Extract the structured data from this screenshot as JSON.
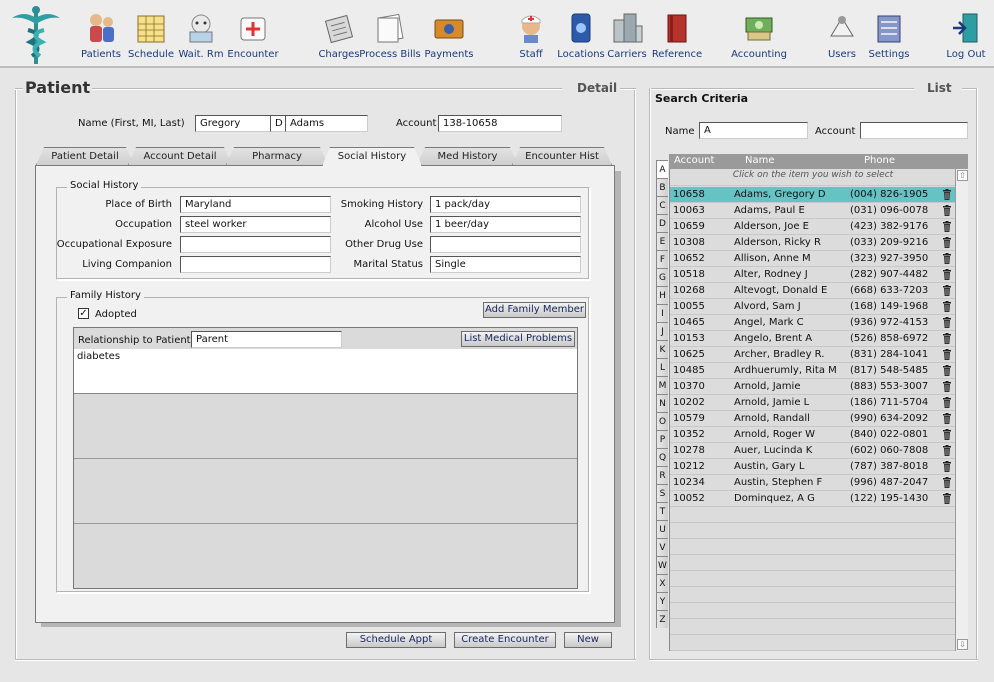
{
  "toolbar": {
    "items": [
      {
        "label": "Patients"
      },
      {
        "label": "Schedule"
      },
      {
        "label": "Wait. Rm"
      },
      {
        "label": "Encounter"
      },
      {
        "label": "Charges"
      },
      {
        "label": "Process Bills"
      },
      {
        "label": "Payments"
      },
      {
        "label": "Staff"
      },
      {
        "label": "Locations"
      },
      {
        "label": "Carriers"
      },
      {
        "label": "Reference"
      },
      {
        "label": "Accounting"
      },
      {
        "label": "Users"
      },
      {
        "label": "Settings"
      },
      {
        "label": "Log Out"
      }
    ]
  },
  "detail": {
    "title": "Patient",
    "subtitle": "Detail",
    "name_label": "Name (First, MI, Last)",
    "first_name": "Gregory",
    "middle_initial": "D",
    "last_name": "Adams",
    "account_label": "Account",
    "account": "138-10658",
    "tabs": [
      "Patient Detail",
      "Account Detail",
      "Pharmacy",
      "Social History",
      "Med History",
      "Encounter Hist"
    ],
    "active_tab": "Social History",
    "social": {
      "title": "Social History",
      "place_of_birth_label": "Place of Birth",
      "place_of_birth": "Maryland",
      "occupation_label": "Occupation",
      "occupation": "steel worker",
      "occ_exposure_label": "Occupational Exposure",
      "occ_exposure": "",
      "living_companion_label": "Living Companion",
      "living_companion": "",
      "smoking_label": "Smoking History",
      "smoking": "1 pack/day",
      "alcohol_label": "Alcohol Use",
      "alcohol": "1 beer/day",
      "other_drug_label": "Other Drug Use",
      "other_drug": "",
      "marital_label": "Marital Status",
      "marital": "Single"
    },
    "family": {
      "title": "Family History",
      "add_member_label": "Add Family Member",
      "adopted_label": "Adopted",
      "adopted_checked": "✓",
      "relationship_label": "Relationship to Patient",
      "relationship": "Parent",
      "list_problems_label": "List Medical Problems",
      "problems": "diabetes"
    },
    "buttons": {
      "schedule": "Schedule Appt",
      "create_encounter": "Create Encounter",
      "new": "New"
    }
  },
  "list_panel": {
    "title": "List",
    "search_title": "Search Criteria",
    "name_label": "Name",
    "name_value": "A",
    "account_label": "Account",
    "account_value": "",
    "columns": [
      "Account",
      "Name",
      "Phone"
    ],
    "hint": "Click on the item you wish to select",
    "letters": [
      "A",
      "B",
      "C",
      "D",
      "E",
      "F",
      "G",
      "H",
      "I",
      "J",
      "K",
      "L",
      "M",
      "N",
      "O",
      "P",
      "Q",
      "R",
      "S",
      "T",
      "U",
      "V",
      "W",
      "X",
      "Y",
      "Z"
    ],
    "rows": [
      {
        "account": "10658",
        "name": "Adams, Gregory D",
        "phone": "(004) 826-1905"
      },
      {
        "account": "10063",
        "name": "Adams, Paul E",
        "phone": "(031) 096-0078"
      },
      {
        "account": "10659",
        "name": "Alderson, Joe E",
        "phone": "(423) 382-9176"
      },
      {
        "account": "10308",
        "name": "Alderson, Ricky R",
        "phone": "(033) 209-9216"
      },
      {
        "account": "10652",
        "name": "Allison, Anne M",
        "phone": "(323) 927-3950"
      },
      {
        "account": "10518",
        "name": "Alter, Rodney J",
        "phone": "(282) 907-4482"
      },
      {
        "account": "10268",
        "name": "Altevogt, Donald E",
        "phone": "(668) 633-7203"
      },
      {
        "account": "10055",
        "name": "Alvord, Sam J",
        "phone": "(168) 149-1968"
      },
      {
        "account": "10465",
        "name": "Angel, Mark C",
        "phone": "(936) 972-4153"
      },
      {
        "account": "10153",
        "name": "Angelo, Brent A",
        "phone": "(526) 858-6972"
      },
      {
        "account": "10625",
        "name": "Archer, Bradley R.",
        "phone": "(831) 284-1041"
      },
      {
        "account": "10485",
        "name": "Ardhuerumly, Rita M",
        "phone": "(817) 548-5485"
      },
      {
        "account": "10370",
        "name": "Arnold, Jamie",
        "phone": "(883) 553-3007"
      },
      {
        "account": "10202",
        "name": "Arnold, Jamie L",
        "phone": "(186) 711-5704"
      },
      {
        "account": "10579",
        "name": "Arnold, Randall",
        "phone": "(990) 634-2092"
      },
      {
        "account": "10352",
        "name": "Arnold, Roger W",
        "phone": "(840) 022-0801"
      },
      {
        "account": "10278",
        "name": "Auer, Lucinda K",
        "phone": "(602) 060-7808"
      },
      {
        "account": "10212",
        "name": "Austin, Gary L",
        "phone": "(787) 387-8018"
      },
      {
        "account": "10234",
        "name": "Austin, Stephen F",
        "phone": "(996) 487-2047"
      },
      {
        "account": "10052",
        "name": "Dominquez, A G",
        "phone": "(122) 195-1430"
      }
    ]
  }
}
